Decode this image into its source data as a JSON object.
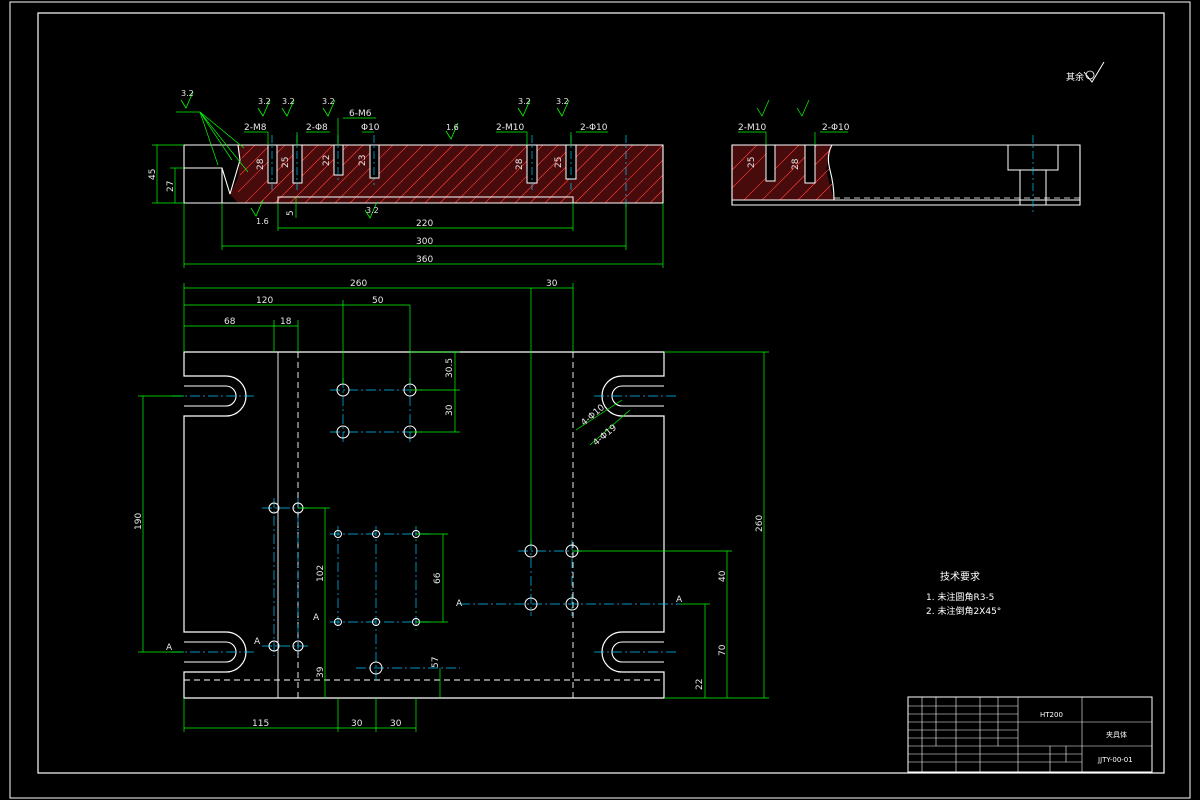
{
  "colors": {
    "background": "#000000",
    "outline": "#ffffff",
    "dimension": "#00ff00",
    "center": "#00c8ff",
    "hatch": "#ff3030"
  },
  "top_view": {
    "callouts": [
      "2-M8",
      "2-Φ8",
      "6-M6",
      "Φ10",
      "2-M10",
      "2-Φ10"
    ],
    "depths": [
      "28",
      "25",
      "22",
      "23",
      "28",
      "25"
    ],
    "roughness": [
      "3.2",
      "3.2",
      "3.2",
      "3.2",
      "3.2",
      "3.2",
      "1.6",
      "1.6",
      "3.2"
    ],
    "dim_45": "45",
    "dim_27": "27",
    "dim_5": "5",
    "dim_220": "220",
    "dim_300": "300",
    "dim_360": "360"
  },
  "side_view": {
    "callouts": [
      "2-M10",
      "2-Φ10"
    ],
    "depths": [
      "25",
      "28"
    ],
    "finish_note": "其余"
  },
  "plan_view": {
    "dims": {
      "d260": "260",
      "d30top": "30",
      "d120": "120",
      "d50": "50",
      "d68": "68",
      "d18": "18",
      "d305": "30.5",
      "d30r": "30",
      "d190": "190",
      "d102": "102",
      "d66": "66",
      "d260r": "260",
      "d40": "40",
      "d70": "70",
      "d57": "57",
      "d39": "39",
      "d22": "22",
      "d115": "115",
      "d30b1": "30",
      "d30b2": "30"
    },
    "hole_labels": [
      "4-Φ10",
      "4-Φ19"
    ],
    "section_marks": [
      "A",
      "A",
      "A",
      "A",
      "A"
    ]
  },
  "notes": {
    "title": "技术要求",
    "items": [
      "1. 未注圆角R3-5",
      "2. 未注倒角2X45°"
    ]
  },
  "title_block": {
    "material": "HT200",
    "part_name": "夹具体",
    "drawing_no": "JJTY-00-01"
  }
}
